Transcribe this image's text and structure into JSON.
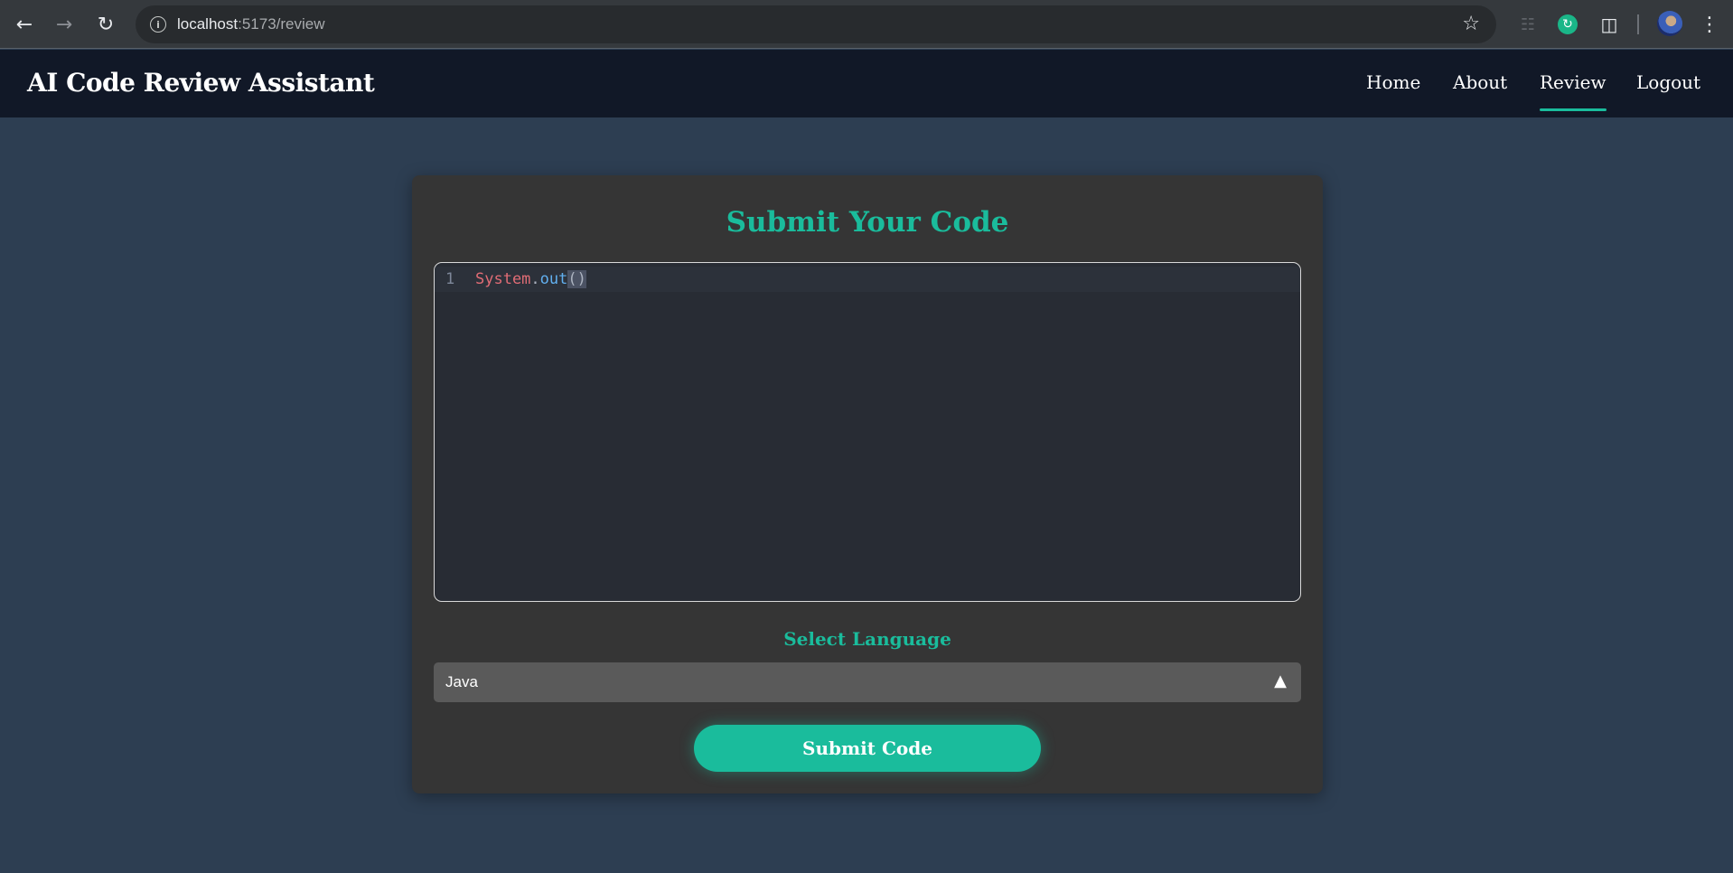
{
  "browser": {
    "url_host": "localhost",
    "url_path": ":5173/review",
    "back_icon": "←",
    "forward_icon": "→",
    "reload_icon": "↻",
    "info_icon": "i",
    "star_icon": "☆",
    "menu_icon": "⋮"
  },
  "header": {
    "brand": "AI Code Review Assistant",
    "nav": [
      "Home",
      "About",
      "Review",
      "Logout"
    ],
    "active": "Review"
  },
  "card": {
    "title": "Submit Your Code",
    "editor": {
      "line_number": "1",
      "tokens": {
        "system": "System",
        "dot": ".",
        "out": "out",
        "parens": "()"
      }
    },
    "language_label": "Select Language",
    "language_value": "Java",
    "language_arrow": "▲",
    "submit_label": "Submit Code"
  },
  "colors": {
    "accent": "#1abc9c",
    "header_bg": "#111827",
    "card_bg": "#353535",
    "page_bg": "#2d3e52",
    "editor_bg": "#282c34"
  }
}
